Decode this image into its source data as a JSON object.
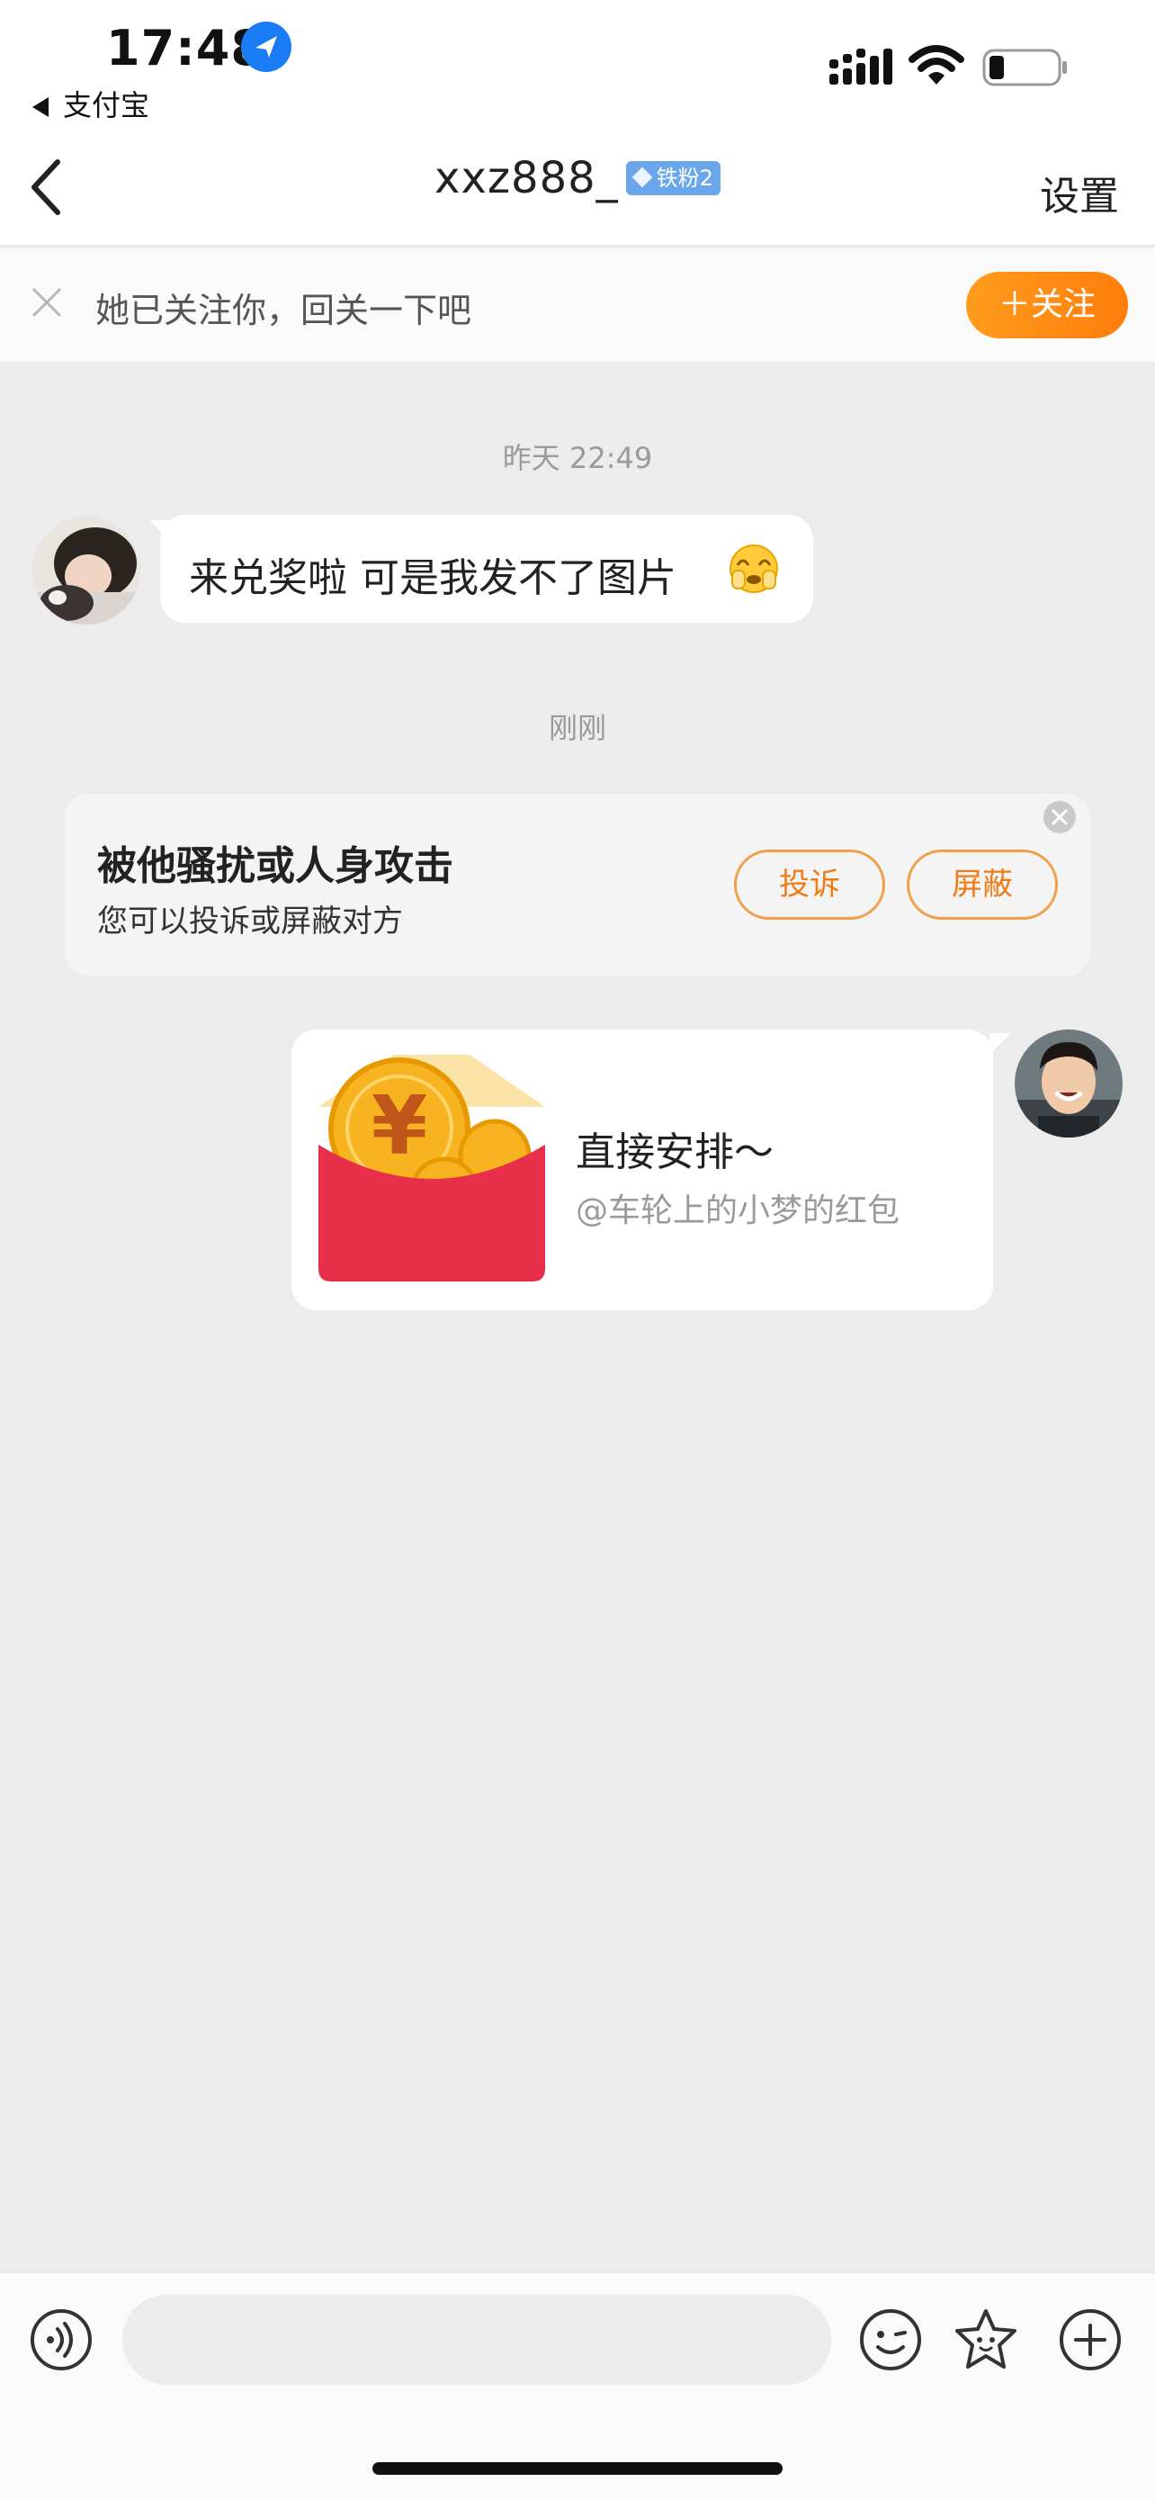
{
  "status_bar": {
    "time": "17:48",
    "back_app": "支付宝"
  },
  "header": {
    "title": "xxz888_",
    "fan_badge": "铁粉2",
    "settings_label": "设置"
  },
  "follow_banner": {
    "text": "她已关注你，回关一下吧",
    "follow_button": "＋关注"
  },
  "chat": {
    "timestamp_1": "昨天 22:49",
    "message_1": "来兑奖啦  可是我发不了图片",
    "timestamp_2": "刚刚",
    "report_card": {
      "title": "被他骚扰或人身攻击",
      "subtitle": "您可以投诉或屏蔽对方",
      "complain_label": "投诉",
      "block_label": "屏蔽"
    },
    "red_packet": {
      "title": "直接安排～",
      "subtitle": "@车轮上的小梦的红包"
    }
  },
  "input_bar": {
    "placeholder": ""
  },
  "colors": {
    "accent_orange": "#ff8a14",
    "background": "#ececec",
    "red_packet": "#e8304a",
    "coin": "#f7b420"
  }
}
